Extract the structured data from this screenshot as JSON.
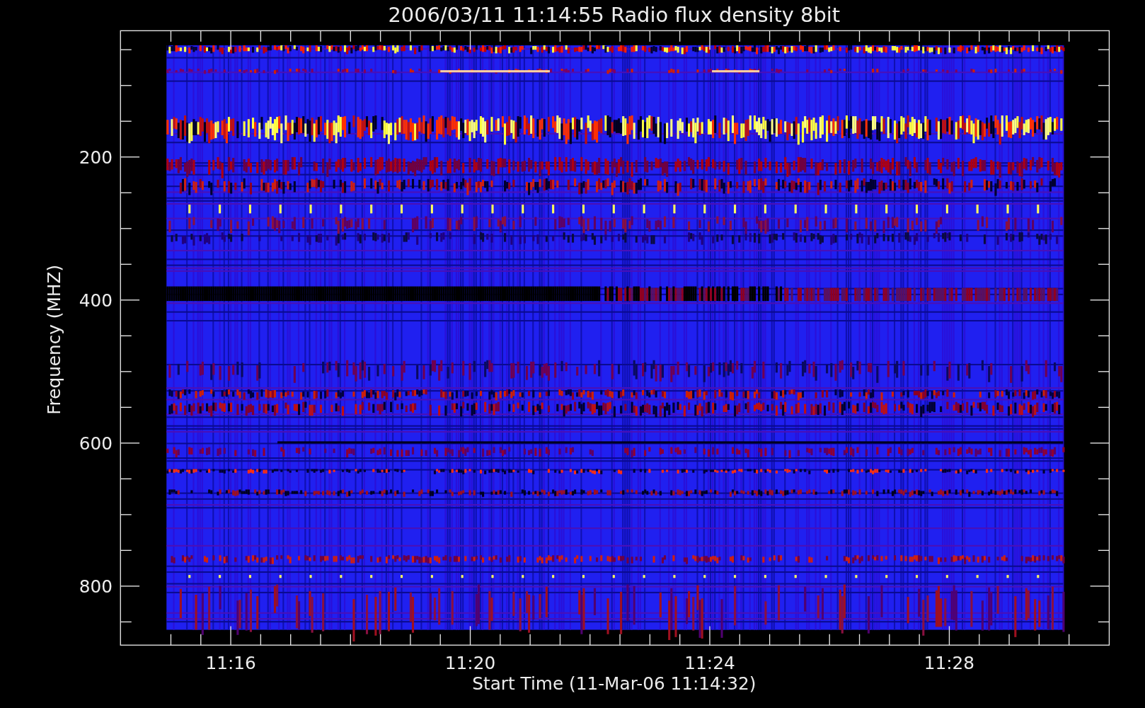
{
  "title": "2006/03/11 11:14:55 Radio flux density 8bit",
  "y_axis": {
    "label": "Frequency (MHZ)",
    "ticks": [
      "200",
      "400",
      "600",
      "800"
    ]
  },
  "x_axis": {
    "label": "Start Time (11-Mar-06 11:14:32)",
    "ticks": [
      "11:16",
      "11:20",
      "11:24",
      "11:28"
    ]
  }
}
